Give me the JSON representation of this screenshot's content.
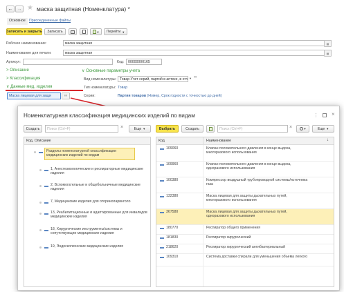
{
  "window": {
    "title": "маска защитная (Номенклатура)",
    "modified_mark": "*",
    "tabs": [
      "Основное",
      "Присоединенные файлы"
    ]
  },
  "toolbar": {
    "save_close_label": "Записать и закрыть",
    "save_label": "Записать",
    "goto_label": "Перейти"
  },
  "form": {
    "work_name_label": "Рабочее наименование:",
    "work_name_value": "маска защитная",
    "print_name_label": "Наименование для печати:",
    "print_name_value": "маска защитная",
    "article_label": "Артикул:",
    "code_label": "Код:",
    "code_value": "00000000165",
    "section_description": "Описание",
    "section_classification": "Классификация",
    "section_medical": "Данные мед. изделия",
    "section_main_params": "Основные параметры учета",
    "kind_label": "Вид номенклатуры:",
    "kind_value": "Товар Учет серий, партий в аптеке, в отч",
    "type_label": "Тип номенклатуры:",
    "type_value": "Товар",
    "series_label": "Серии:",
    "series_link": "Партия товаров",
    "series_detail": "(Номер, Срок годности с точностью до дней)",
    "medical_field_value": "Маска лицевая для защи"
  },
  "dialog": {
    "title": "Номенклатурная классификация медицинских изделий по видам",
    "left": {
      "create_label": "Создать",
      "search_placeholder": "Поиск (Ctrl+F)",
      "more_label": "Еще",
      "col_header": "Код, Описание",
      "items": [
        "Разделы номенклатурной классификации медицинских изделий по видам",
        "1, Анестезиологические и респираторные медицинские изделия",
        "2, Вспомогательные и общебольничные медицинские изделия",
        "7, Медицинские изделия для оториноларинголо",
        "13, Реабилитационные и адаптированные для инвалидов медицинские изделия",
        "18, Хирургические инструменты/системы и сопутствующие медицинские изделия",
        "19, Эндоскопические медицинские изделия"
      ]
    },
    "right": {
      "select_label": "Выбрать",
      "create_label": "Создать",
      "search_placeholder": "Поиск (Ctrl+F)",
      "more_label": "Еще",
      "col_code": "Код",
      "col_name": "Наименование",
      "rows": [
        {
          "code": "109060",
          "name": "Клапан положительного давления в конце выдоха, многоразового использования"
        },
        {
          "code": "109960",
          "name": "Клапан положительного давления в конце выдоха, одноразового использования"
        },
        {
          "code": "100380",
          "name": "Компрессор воздушный трубопроводной системы/источника газа"
        },
        {
          "code": "132380",
          "name": "Маска лицевая для защиты дыхательных путей, многоразового использования"
        },
        {
          "code": "367580",
          "name": "Маска лицевая для защиты дыхательных путей, одноразового использования"
        },
        {
          "code": "180770",
          "name": "Респиратор общего применения"
        },
        {
          "code": "181830",
          "name": "Респиратор хирургический"
        },
        {
          "code": "218620",
          "name": "Респиратор хирургический антибактериальный"
        },
        {
          "code": "109310",
          "name": "Система доставки спирали для уменьшения объема легкого"
        }
      ]
    }
  },
  "colors": {
    "accent_yellow": "#f8e44b",
    "selected_row": "#fdf0b8",
    "arrow_red": "#d9262b",
    "link_blue": "#3d6aa6",
    "section_green": "#3f9a3f"
  }
}
